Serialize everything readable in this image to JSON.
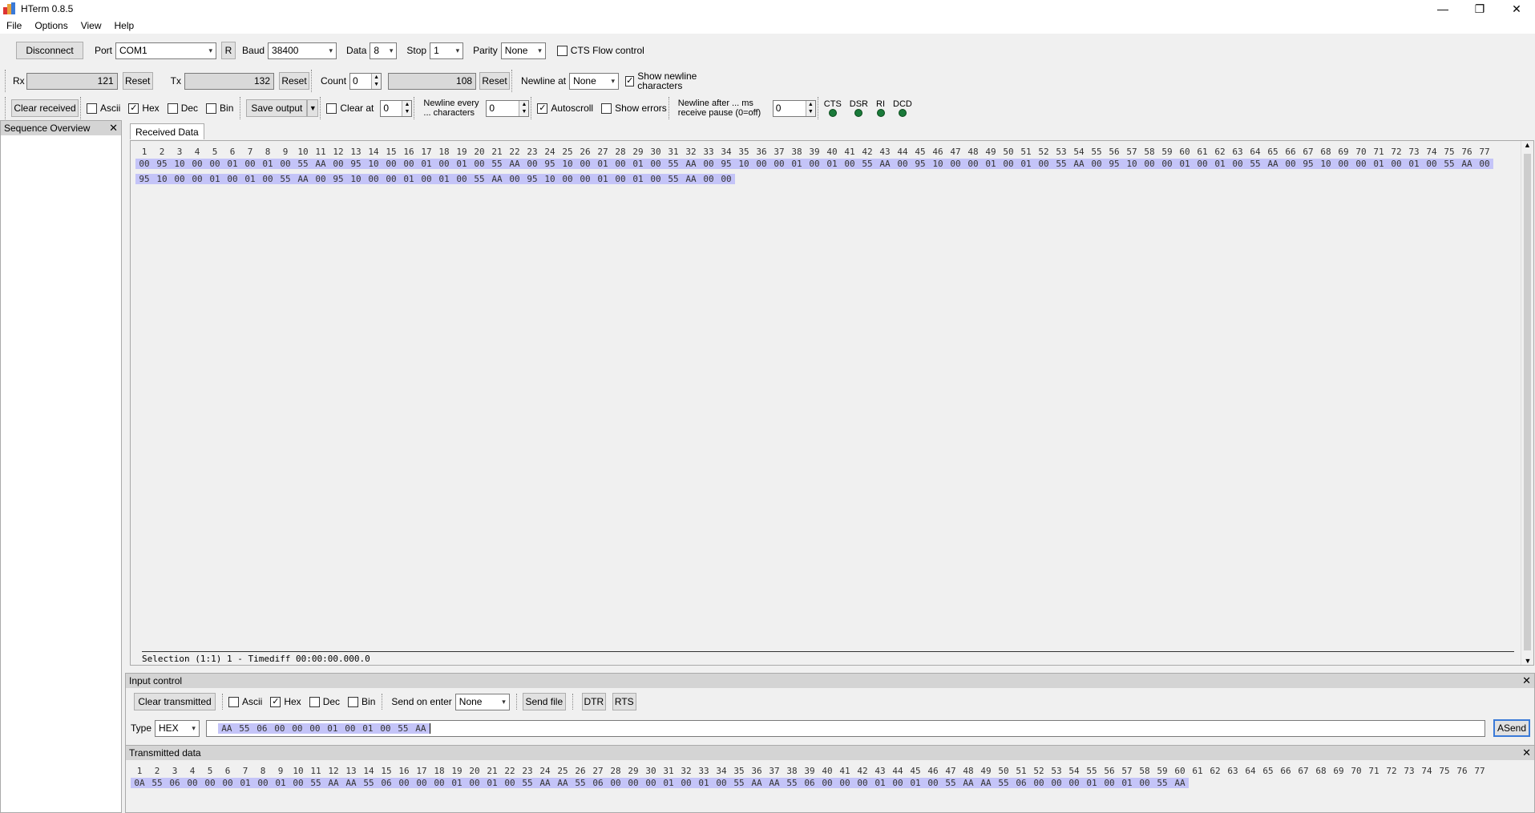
{
  "window": {
    "title": "HTerm 0.8.5",
    "controls": {
      "minimize": "—",
      "restore": "❐",
      "close": "✕"
    }
  },
  "menu": [
    "File",
    "Options",
    "View",
    "Help"
  ],
  "connection": {
    "disconnect_label": "Disconnect",
    "port_label": "Port",
    "port_value": "COM1",
    "refresh_label": "R",
    "baud_label": "Baud",
    "baud_value": "38400",
    "data_label": "Data",
    "data_value": "8",
    "stop_label": "Stop",
    "stop_value": "1",
    "parity_label": "Parity",
    "parity_value": "None",
    "cts_label": "CTS Flow control"
  },
  "counters": {
    "rx_label": "Rx",
    "rx_value": "121",
    "rx_reset": "Reset",
    "tx_label": "Tx",
    "tx_value": "132",
    "tx_reset": "Reset",
    "count_label": "Count",
    "count_value": "0",
    "count_field": "108",
    "count_reset": "Reset",
    "newline_at_label": "Newline at",
    "newline_at_value": "None",
    "show_newline_label": "Show newline characters"
  },
  "display": {
    "clear_received": "Clear received",
    "ascii": "Ascii",
    "hex": "Hex",
    "dec": "Dec",
    "bin": "Bin",
    "save_output": "Save output",
    "clear_at": "Clear at",
    "clear_at_value": "0",
    "newline_every": "Newline every ... characters",
    "newline_every_value": "0",
    "autoscroll": "Autoscroll",
    "show_errors": "Show errors",
    "newline_after": "Newline after ... ms receive pause (0=off)",
    "newline_after_value": "0",
    "cts": "CTS",
    "dsr": "DSR",
    "ri": "RI",
    "dcd": "DCD"
  },
  "sequence_overview": {
    "title": "Sequence Overview",
    "close": "✕"
  },
  "received": {
    "tab": "Received Data",
    "row1": [
      "00",
      "95",
      "10",
      "00",
      "00",
      "01",
      "00",
      "01",
      "00",
      "55",
      "AA",
      "00",
      "95",
      "10",
      "00",
      "00",
      "01",
      "00",
      "01",
      "00",
      "55",
      "AA",
      "00",
      "95",
      "10",
      "00",
      "01",
      "00",
      "01",
      "00",
      "55",
      "AA",
      "00",
      "95",
      "10",
      "00",
      "00",
      "01",
      "00",
      "01",
      "00",
      "55",
      "AA",
      "00",
      "95",
      "10",
      "00",
      "00",
      "01",
      "00",
      "01",
      "00",
      "55",
      "AA",
      "00",
      "95",
      "10",
      "00",
      "00",
      "01",
      "00",
      "01",
      "00",
      "55",
      "AA",
      "00",
      "95",
      "10",
      "00",
      "00",
      "01",
      "00",
      "01",
      "00",
      "55",
      "AA",
      "00"
    ],
    "row2": [
      "95",
      "10",
      "00",
      "00",
      "01",
      "00",
      "01",
      "00",
      "55",
      "AA",
      "00",
      "95",
      "10",
      "00",
      "00",
      "01",
      "00",
      "01",
      "00",
      "55",
      "AA",
      "00",
      "95",
      "10",
      "00",
      "00",
      "01",
      "00",
      "01",
      "00",
      "55",
      "AA",
      "00",
      "00"
    ],
    "status": "Selection (1:1) 1  -  Timediff 00:00:00.000.0"
  },
  "input": {
    "title": "Input control",
    "close": "✕",
    "clear_transmitted": "Clear transmitted",
    "ascii": "Ascii",
    "hex": "Hex",
    "dec": "Dec",
    "bin": "Bin",
    "send_on_enter": "Send on enter",
    "send_on_enter_value": "None",
    "send_file": "Send file",
    "dtr": "DTR",
    "rts": "RTS",
    "type_label": "Type",
    "type_value": "HEX",
    "bytes": [
      "AA",
      "55",
      "06",
      "00",
      "00",
      "00",
      "01",
      "00",
      "01",
      "00",
      "55",
      "AA"
    ],
    "asend": "ASend"
  },
  "transmitted": {
    "title": "Transmitted data",
    "close": "✕",
    "row": [
      "0A",
      "55",
      "06",
      "00",
      "00",
      "00",
      "01",
      "00",
      "01",
      "00",
      "55",
      "AA",
      "AA",
      "55",
      "06",
      "00",
      "00",
      "00",
      "01",
      "00",
      "01",
      "00",
      "55",
      "AA",
      "AA",
      "55",
      "06",
      "00",
      "00",
      "00",
      "01",
      "00",
      "01",
      "00",
      "55",
      "AA",
      "AA",
      "55",
      "06",
      "00",
      "00",
      "00",
      "01",
      "00",
      "01",
      "00",
      "55",
      "AA",
      "AA",
      "55",
      "06",
      "00",
      "00",
      "00",
      "01",
      "00",
      "01",
      "00",
      "55",
      "AA"
    ]
  },
  "colors": {
    "highlight": "#c4c4f8",
    "led": "#1a7a3a"
  }
}
